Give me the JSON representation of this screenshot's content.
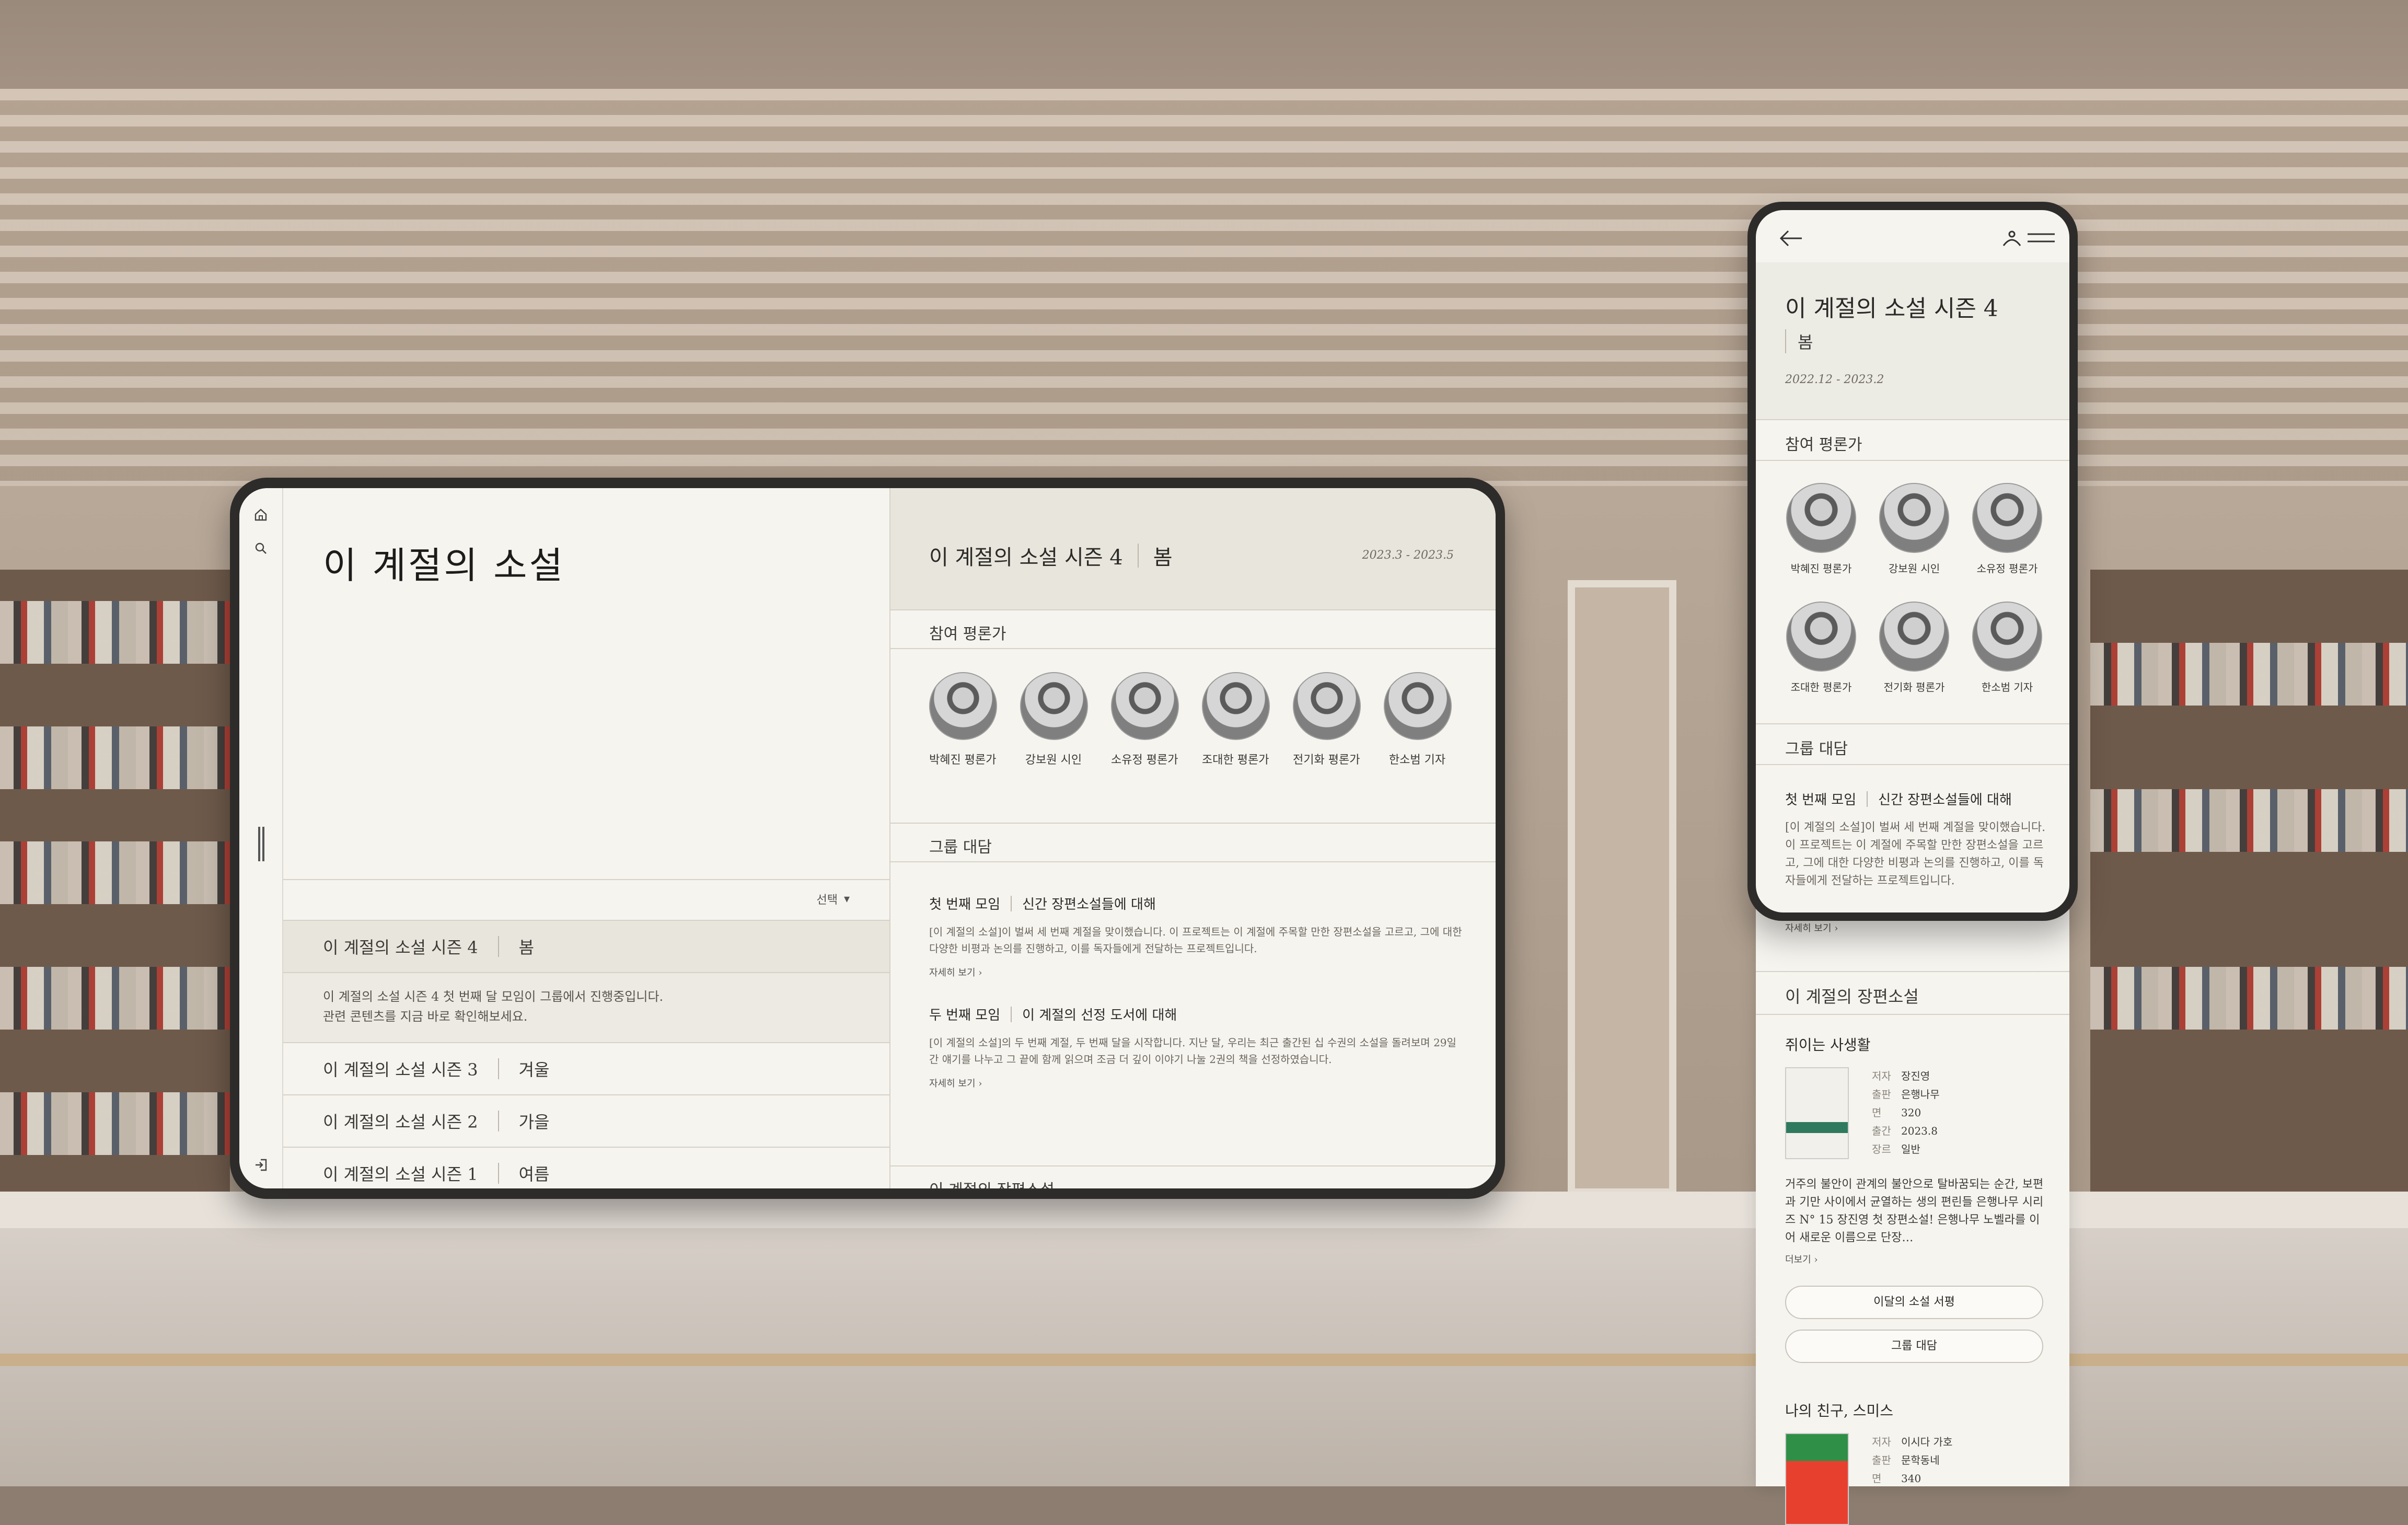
{
  "tablet": {
    "app_title": "이 계절의 소설",
    "sort_label": "선택",
    "seasons": [
      {
        "name": "이 계절의 소설 시즌 4",
        "tag": "봄",
        "desc_1": "이 계절의 소설 시즌 4 첫 번째 달 모임이 그룹에서 진행중입니다.",
        "desc_2": "관련 콘텐츠를 지금 바로 확인해보세요."
      },
      {
        "name": "이 계절의 소설 시즌 3",
        "tag": "겨울"
      },
      {
        "name": "이 계절의 소설 시즌 2",
        "tag": "가을"
      },
      {
        "name": "이 계절의 소설 시즌 1",
        "tag": "여름"
      }
    ],
    "detail": {
      "title": "이 계절의 소설 시즌 4",
      "tag": "봄",
      "date": "2023.3 - 2023.5",
      "critics_heading": "참여 평론가",
      "critics": [
        "박혜진 평론가",
        "강보원 시인",
        "소유정 평론가",
        "조대한 평론가",
        "전기화 평론가",
        "한소범 기자"
      ],
      "talk_heading": "그룹 대담",
      "talks": [
        {
          "label": "첫 번째 모임",
          "topic": "신간 장편소설들에 대해",
          "body": "[이 계절의 소설]이 벌써 세 번째 계절을 맞이했습니다. 이 프로젝트는 이 계절에 주목할 만한 장편소설을 고르고, 그에 대한 다양한 비평과 논의를 진행하고, 이를 독자들에게 전달하는 프로젝트입니다.",
          "more": "자세히 보기 ›"
        },
        {
          "label": "두 번째 모임",
          "topic": "이 계절의 선정 도서에 대해",
          "body": "[이 계절의 소설]의 두 번째 계절, 두 번째 달을 시작합니다. 지난 달, 우리는 최근 출간된 십 수권의 소설을 돌려보며 29일간 얘기를 나누고 그 끝에 함께 읽으며 조금 더 깊이 이야기 나눌 2권의 책을 선정하였습니다.",
          "more": "자세히 보기 ›"
        }
      ],
      "novels_heading": "이 계절의 장편소설"
    }
  },
  "phone": {
    "title": "이 계절의 소설 시즌 4",
    "tag": "봄",
    "date": "2022.12 - 2023.2",
    "critics_heading": "참여 평론가",
    "critics": [
      "박혜진 평론가",
      "강보원 시인",
      "소유정 평론가",
      "조대한 평론가",
      "전기화 평론가",
      "한소범 기자"
    ],
    "talk_heading": "그룹 대담",
    "talk": {
      "label": "첫 번째 모임",
      "topic": "신간 장편소설들에 대해",
      "body": "[이 계절의 소설]이 벌써 세 번째 계절을 맞이했습니다. 이 프로젝트는 이 계절에 주목할 만한 장편소설을 고르고, 그에 대한 다양한 비평과 논의를 진행하고, 이를 독자들에게 전달하는 프로젝트입니다.",
      "more": "자세히 보기 ›"
    },
    "novels_heading": "이 계절의 장편소설",
    "books": [
      {
        "title": "쥐이는 사생활",
        "author_k": "저자",
        "author": "장진영",
        "pub_k": "출판",
        "pub": "은행나무",
        "pages_k": "면",
        "pages": "320",
        "date_k": "출간",
        "date": "2023.8",
        "genre_k": "장르",
        "genre": "일반",
        "desc": "거주의 불안이 관계의 불안으로 탈바꿈되는 순간, 보편과 기만 사이에서 균열하는 생의 편린들 은행나무 시리즈 N° 15 장진영 첫 장편소설! 은행나무 노벨라를 이어 새로운 이름으로 단장…",
        "more": "더보기 ›"
      },
      {
        "title": "나의 친구, 스미스",
        "author_k": "저자",
        "author": "이시다 가호",
        "pub_k": "출판",
        "pub": "문학동네",
        "pages_k": "면",
        "pages": "340"
      }
    ],
    "buttons": {
      "review": "이달의 소설 서평",
      "talk": "그룹 대담"
    }
  }
}
